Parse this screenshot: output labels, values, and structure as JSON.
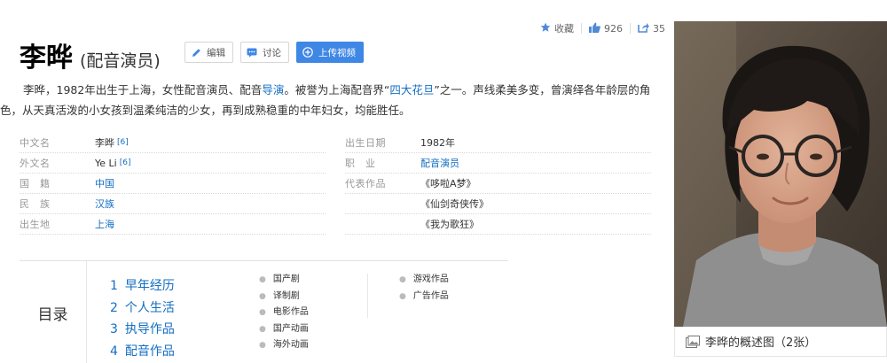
{
  "stats": {
    "favorite_label": "收藏",
    "likes": "926",
    "shares": "35"
  },
  "title": {
    "name": "李晔",
    "subtitle": "(配音演员)"
  },
  "buttons": {
    "edit": "编辑",
    "discuss": "讨论",
    "upload": "上传视频"
  },
  "summary": {
    "p1": "李晔，1982年出生于上海，女性配音演员、配音",
    "link1": "导演",
    "p2": "。被誉为上海配音界“",
    "link2": "四大花旦",
    "p3": "”之一。声线柔美多变，曾演绎各年龄层的角色，从天真活泼的小女孩到温柔纯洁的少女，再到成熟稳重的中年妇女，均能胜任。"
  },
  "info_left": [
    {
      "key": "中文名",
      "value": "李晔",
      "ref": "[6]",
      "link": false
    },
    {
      "key": "外文名",
      "value": "Ye Li",
      "ref": "[6]",
      "link": false
    },
    {
      "key": "国　籍",
      "value": "中国",
      "ref": "",
      "link": true
    },
    {
      "key": "民　族",
      "value": "汉族",
      "ref": "",
      "link": true
    },
    {
      "key": "出生地",
      "value": "上海",
      "ref": "",
      "link": true
    }
  ],
  "info_right": [
    {
      "key": "出生日期",
      "value": "1982年",
      "link": false
    },
    {
      "key": "职　业",
      "value": "配音演员",
      "link": true
    },
    {
      "key": "代表作品",
      "value": "《哆啦A梦》",
      "link": false
    },
    {
      "key": "",
      "value": "《仙剑奇侠传》",
      "link": false
    },
    {
      "key": "",
      "value": "《我为歌狂》",
      "link": false
    }
  ],
  "catalog": {
    "heading": "目录",
    "main": [
      {
        "num": "1",
        "label": "早年经历"
      },
      {
        "num": "2",
        "label": "个人生活"
      },
      {
        "num": "3",
        "label": "执导作品"
      },
      {
        "num": "4",
        "label": "配音作品"
      }
    ],
    "sub1": [
      "国产剧",
      "译制剧",
      "电影作品",
      "国产动画",
      "海外动画"
    ],
    "sub2": [
      "游戏作品",
      "广告作品"
    ]
  },
  "photo": {
    "caption": "李晔的概述图（2张）"
  },
  "colors": {
    "link": "#136ec2",
    "primary_button": "#3f87e5"
  }
}
